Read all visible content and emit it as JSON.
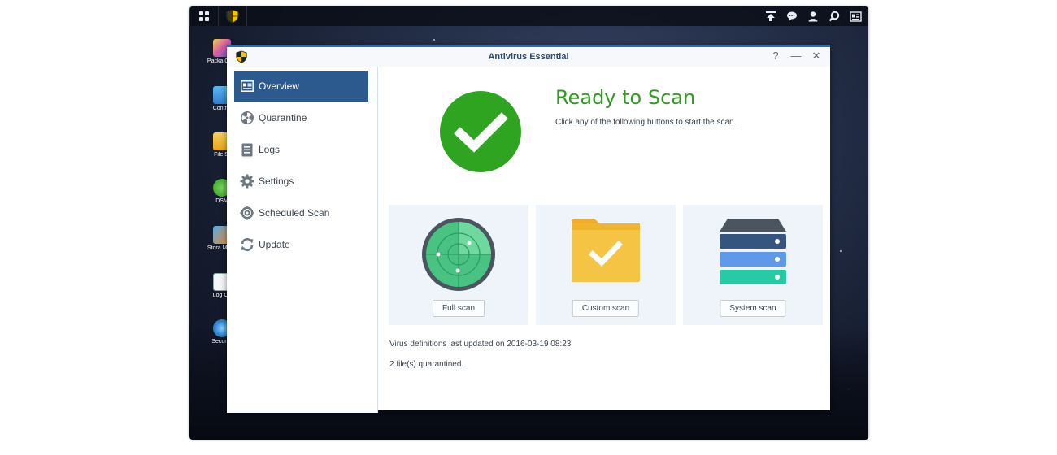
{
  "taskbar": {
    "left_icons": [
      "main-menu-icon",
      "antivirus-app-icon"
    ],
    "right_icons": [
      "upload-icon",
      "chat-icon",
      "user-icon",
      "search-icon",
      "widgets-icon"
    ]
  },
  "desktop": {
    "icons": [
      {
        "label": "Packa Cent",
        "name": "package-center-icon",
        "color": "#d65aa6"
      },
      {
        "label": "Control",
        "name": "control-panel-icon",
        "color": "#2f8fd8"
      },
      {
        "label": "File St",
        "name": "file-station-icon",
        "color": "#f0b429"
      },
      {
        "label": "DSM",
        "name": "dsm-help-icon",
        "color": "#5cb85c"
      },
      {
        "label": "Stora Mana",
        "name": "storage-manager-icon",
        "color": "#e58a2e"
      },
      {
        "label": "Log Ce",
        "name": "log-center-icon",
        "color": "#ffffff"
      },
      {
        "label": "Security",
        "name": "security-advisor-icon",
        "color": "#3a8fd8"
      }
    ]
  },
  "window": {
    "title": "Antivirus Essential",
    "controls": {
      "help": "?",
      "minimize": "—",
      "close": "✕"
    }
  },
  "sidebar": {
    "items": [
      {
        "label": "Overview",
        "icon": "overview-icon",
        "active": true
      },
      {
        "label": "Quarantine",
        "icon": "radiation-icon",
        "active": false
      },
      {
        "label": "Logs",
        "icon": "logs-icon",
        "active": false
      },
      {
        "label": "Settings",
        "icon": "gear-icon",
        "active": false
      },
      {
        "label": "Scheduled Scan",
        "icon": "target-icon",
        "active": false
      },
      {
        "label": "Update",
        "icon": "refresh-icon",
        "active": false
      }
    ]
  },
  "main": {
    "ready_title": "Ready to Scan",
    "ready_subtitle": "Click any of the following buttons to start the scan.",
    "cards": [
      {
        "button": "Full scan",
        "icon": "radar-icon"
      },
      {
        "button": "Custom scan",
        "icon": "folder-check-icon"
      },
      {
        "button": "System scan",
        "icon": "server-stack-icon"
      }
    ],
    "definitions_text": "Virus definitions last updated on 2016-03-19 08:23",
    "quarantine_text": "2 file(s) quarantined."
  },
  "colors": {
    "accent": "#2c5a8e",
    "success": "#2fa421",
    "title_green": "#2f9c1f",
    "card_bg": "#eef4fa"
  }
}
